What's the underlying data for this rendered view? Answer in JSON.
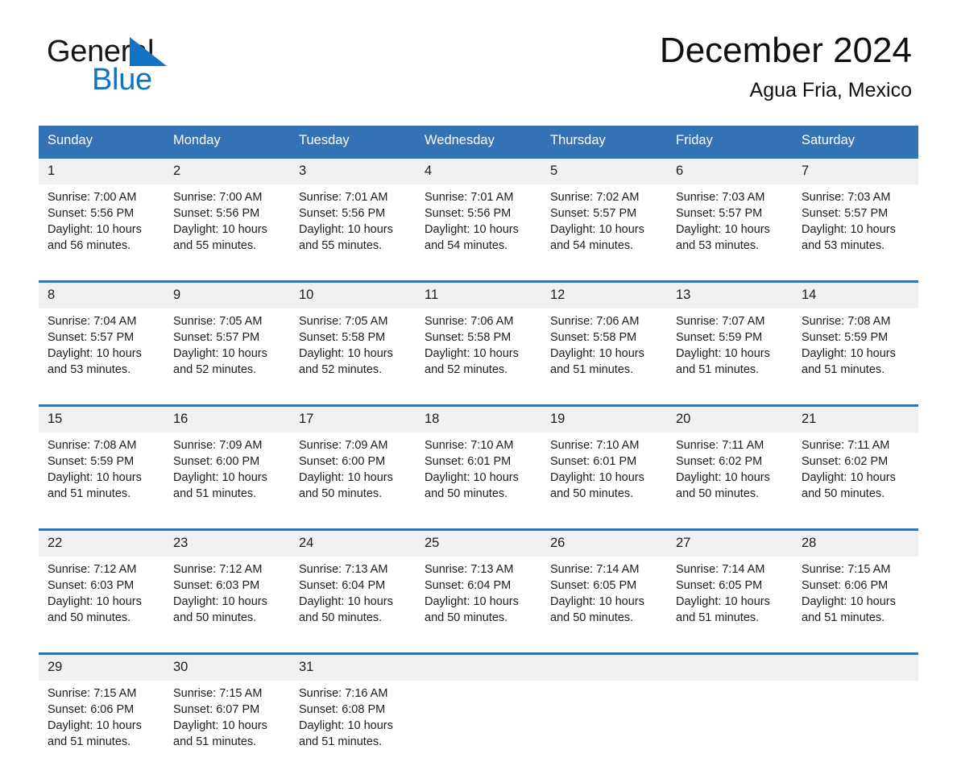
{
  "brand": {
    "name_part1": "General",
    "name_part2": "Blue",
    "flag_icon": "triangle-flag-icon",
    "accent_color": "#1273c4"
  },
  "header": {
    "title": "December 2024",
    "location": "Agua Fria, Mexico"
  },
  "theme": {
    "header_blue": "#3272b5",
    "date_band_gray": "#f1f1f1",
    "text_color": "#1c1c1e"
  },
  "calendar": {
    "weekday_headers": [
      "Sunday",
      "Monday",
      "Tuesday",
      "Wednesday",
      "Thursday",
      "Friday",
      "Saturday"
    ],
    "weeks": [
      {
        "days": [
          {
            "date": "1",
            "sunrise": "Sunrise: 7:00 AM",
            "sunset": "Sunset: 5:56 PM",
            "daylight_line1": "Daylight: 10 hours",
            "daylight_line2": "and 56 minutes."
          },
          {
            "date": "2",
            "sunrise": "Sunrise: 7:00 AM",
            "sunset": "Sunset: 5:56 PM",
            "daylight_line1": "Daylight: 10 hours",
            "daylight_line2": "and 55 minutes."
          },
          {
            "date": "3",
            "sunrise": "Sunrise: 7:01 AM",
            "sunset": "Sunset: 5:56 PM",
            "daylight_line1": "Daylight: 10 hours",
            "daylight_line2": "and 55 minutes."
          },
          {
            "date": "4",
            "sunrise": "Sunrise: 7:01 AM",
            "sunset": "Sunset: 5:56 PM",
            "daylight_line1": "Daylight: 10 hours",
            "daylight_line2": "and 54 minutes."
          },
          {
            "date": "5",
            "sunrise": "Sunrise: 7:02 AM",
            "sunset": "Sunset: 5:57 PM",
            "daylight_line1": "Daylight: 10 hours",
            "daylight_line2": "and 54 minutes."
          },
          {
            "date": "6",
            "sunrise": "Sunrise: 7:03 AM",
            "sunset": "Sunset: 5:57 PM",
            "daylight_line1": "Daylight: 10 hours",
            "daylight_line2": "and 53 minutes."
          },
          {
            "date": "7",
            "sunrise": "Sunrise: 7:03 AM",
            "sunset": "Sunset: 5:57 PM",
            "daylight_line1": "Daylight: 10 hours",
            "daylight_line2": "and 53 minutes."
          }
        ]
      },
      {
        "days": [
          {
            "date": "8",
            "sunrise": "Sunrise: 7:04 AM",
            "sunset": "Sunset: 5:57 PM",
            "daylight_line1": "Daylight: 10 hours",
            "daylight_line2": "and 53 minutes."
          },
          {
            "date": "9",
            "sunrise": "Sunrise: 7:05 AM",
            "sunset": "Sunset: 5:57 PM",
            "daylight_line1": "Daylight: 10 hours",
            "daylight_line2": "and 52 minutes."
          },
          {
            "date": "10",
            "sunrise": "Sunrise: 7:05 AM",
            "sunset": "Sunset: 5:58 PM",
            "daylight_line1": "Daylight: 10 hours",
            "daylight_line2": "and 52 minutes."
          },
          {
            "date": "11",
            "sunrise": "Sunrise: 7:06 AM",
            "sunset": "Sunset: 5:58 PM",
            "daylight_line1": "Daylight: 10 hours",
            "daylight_line2": "and 52 minutes."
          },
          {
            "date": "12",
            "sunrise": "Sunrise: 7:06 AM",
            "sunset": "Sunset: 5:58 PM",
            "daylight_line1": "Daylight: 10 hours",
            "daylight_line2": "and 51 minutes."
          },
          {
            "date": "13",
            "sunrise": "Sunrise: 7:07 AM",
            "sunset": "Sunset: 5:59 PM",
            "daylight_line1": "Daylight: 10 hours",
            "daylight_line2": "and 51 minutes."
          },
          {
            "date": "14",
            "sunrise": "Sunrise: 7:08 AM",
            "sunset": "Sunset: 5:59 PM",
            "daylight_line1": "Daylight: 10 hours",
            "daylight_line2": "and 51 minutes."
          }
        ]
      },
      {
        "days": [
          {
            "date": "15",
            "sunrise": "Sunrise: 7:08 AM",
            "sunset": "Sunset: 5:59 PM",
            "daylight_line1": "Daylight: 10 hours",
            "daylight_line2": "and 51 minutes."
          },
          {
            "date": "16",
            "sunrise": "Sunrise: 7:09 AM",
            "sunset": "Sunset: 6:00 PM",
            "daylight_line1": "Daylight: 10 hours",
            "daylight_line2": "and 51 minutes."
          },
          {
            "date": "17",
            "sunrise": "Sunrise: 7:09 AM",
            "sunset": "Sunset: 6:00 PM",
            "daylight_line1": "Daylight: 10 hours",
            "daylight_line2": "and 50 minutes."
          },
          {
            "date": "18",
            "sunrise": "Sunrise: 7:10 AM",
            "sunset": "Sunset: 6:01 PM",
            "daylight_line1": "Daylight: 10 hours",
            "daylight_line2": "and 50 minutes."
          },
          {
            "date": "19",
            "sunrise": "Sunrise: 7:10 AM",
            "sunset": "Sunset: 6:01 PM",
            "daylight_line1": "Daylight: 10 hours",
            "daylight_line2": "and 50 minutes."
          },
          {
            "date": "20",
            "sunrise": "Sunrise: 7:11 AM",
            "sunset": "Sunset: 6:02 PM",
            "daylight_line1": "Daylight: 10 hours",
            "daylight_line2": "and 50 minutes."
          },
          {
            "date": "21",
            "sunrise": "Sunrise: 7:11 AM",
            "sunset": "Sunset: 6:02 PM",
            "daylight_line1": "Daylight: 10 hours",
            "daylight_line2": "and 50 minutes."
          }
        ]
      },
      {
        "days": [
          {
            "date": "22",
            "sunrise": "Sunrise: 7:12 AM",
            "sunset": "Sunset: 6:03 PM",
            "daylight_line1": "Daylight: 10 hours",
            "daylight_line2": "and 50 minutes."
          },
          {
            "date": "23",
            "sunrise": "Sunrise: 7:12 AM",
            "sunset": "Sunset: 6:03 PM",
            "daylight_line1": "Daylight: 10 hours",
            "daylight_line2": "and 50 minutes."
          },
          {
            "date": "24",
            "sunrise": "Sunrise: 7:13 AM",
            "sunset": "Sunset: 6:04 PM",
            "daylight_line1": "Daylight: 10 hours",
            "daylight_line2": "and 50 minutes."
          },
          {
            "date": "25",
            "sunrise": "Sunrise: 7:13 AM",
            "sunset": "Sunset: 6:04 PM",
            "daylight_line1": "Daylight: 10 hours",
            "daylight_line2": "and 50 minutes."
          },
          {
            "date": "26",
            "sunrise": "Sunrise: 7:14 AM",
            "sunset": "Sunset: 6:05 PM",
            "daylight_line1": "Daylight: 10 hours",
            "daylight_line2": "and 50 minutes."
          },
          {
            "date": "27",
            "sunrise": "Sunrise: 7:14 AM",
            "sunset": "Sunset: 6:05 PM",
            "daylight_line1": "Daylight: 10 hours",
            "daylight_line2": "and 51 minutes."
          },
          {
            "date": "28",
            "sunrise": "Sunrise: 7:15 AM",
            "sunset": "Sunset: 6:06 PM",
            "daylight_line1": "Daylight: 10 hours",
            "daylight_line2": "and 51 minutes."
          }
        ]
      },
      {
        "days": [
          {
            "date": "29",
            "sunrise": "Sunrise: 7:15 AM",
            "sunset": "Sunset: 6:06 PM",
            "daylight_line1": "Daylight: 10 hours",
            "daylight_line2": "and 51 minutes."
          },
          {
            "date": "30",
            "sunrise": "Sunrise: 7:15 AM",
            "sunset": "Sunset: 6:07 PM",
            "daylight_line1": "Daylight: 10 hours",
            "daylight_line2": "and 51 minutes."
          },
          {
            "date": "31",
            "sunrise": "Sunrise: 7:16 AM",
            "sunset": "Sunset: 6:08 PM",
            "daylight_line1": "Daylight: 10 hours",
            "daylight_line2": "and 51 minutes."
          },
          {
            "date": "",
            "sunrise": "",
            "sunset": "",
            "daylight_line1": "",
            "daylight_line2": ""
          },
          {
            "date": "",
            "sunrise": "",
            "sunset": "",
            "daylight_line1": "",
            "daylight_line2": ""
          },
          {
            "date": "",
            "sunrise": "",
            "sunset": "",
            "daylight_line1": "",
            "daylight_line2": ""
          },
          {
            "date": "",
            "sunrise": "",
            "sunset": "",
            "daylight_line1": "",
            "daylight_line2": ""
          }
        ]
      }
    ]
  }
}
